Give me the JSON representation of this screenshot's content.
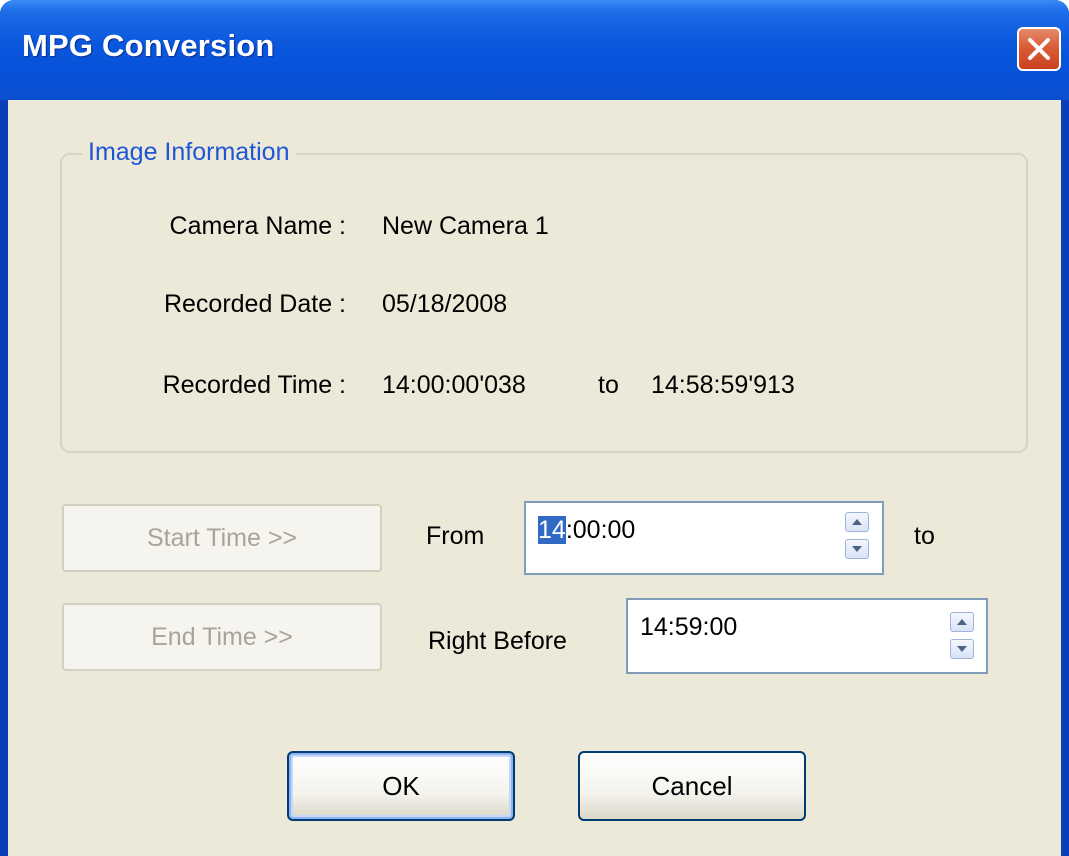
{
  "window": {
    "title": "MPG Conversion",
    "colors": {
      "titlebar": "#0a56dc",
      "client": "#ece9d8",
      "close": "#dc5c38",
      "selection": "#316ac5",
      "group_legend": "#1f56d6"
    }
  },
  "image_info": {
    "legend": "Image Information",
    "camera_name_label": "Camera Name :",
    "camera_name_value": "New Camera 1",
    "recorded_date_label": "Recorded Date :",
    "recorded_date_value": "05/18/2008",
    "recorded_time_label": "Recorded Time :",
    "recorded_time_start": "14:00:00'038",
    "recorded_time_to": "to",
    "recorded_time_end": "14:58:59'913"
  },
  "range": {
    "start_button": "Start Time >>",
    "end_button": "End Time >>",
    "from_label": "From",
    "from_selected": "14",
    "from_rest": ":00:00",
    "to_label": "to",
    "right_before_label": "Right Before",
    "right_before_value": "14:59:00"
  },
  "actions": {
    "ok": "OK",
    "cancel": "Cancel"
  },
  "icons": {
    "close": "close-x-icon",
    "spin_up": "triangle-up-icon",
    "spin_down": "triangle-down-icon"
  }
}
